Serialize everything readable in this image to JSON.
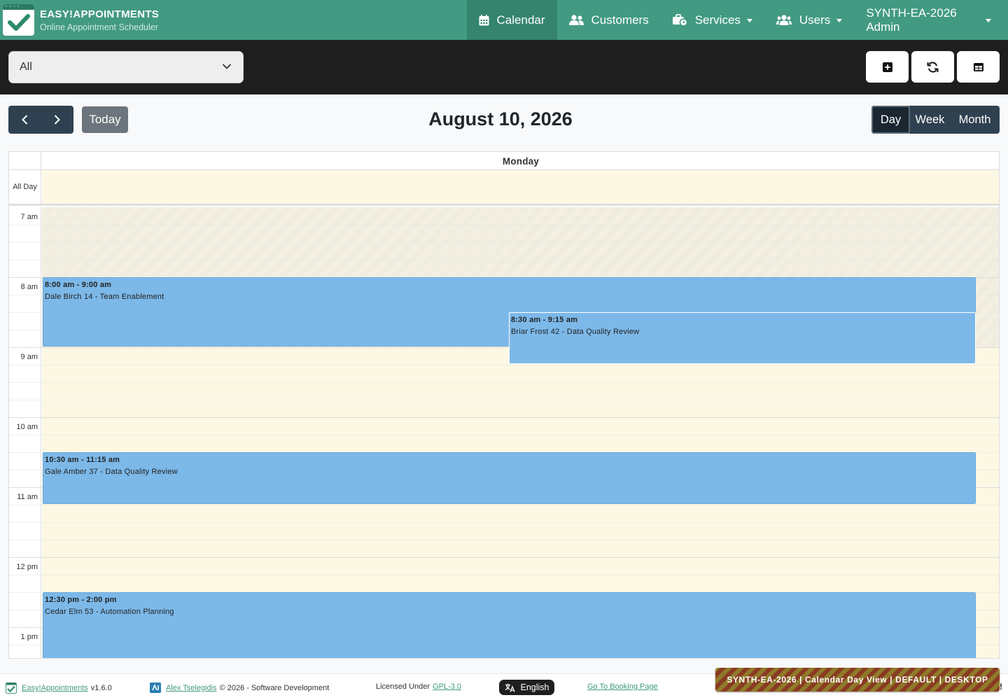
{
  "brand": {
    "name": "EASY!APPOINTMENTS",
    "tagline": "Online Appointment Scheduler"
  },
  "nav": {
    "calendar": "Calendar",
    "customers": "Customers",
    "services": "Services",
    "users": "Users",
    "account": "SYNTH-EA-2026 Admin"
  },
  "toolbar": {
    "filter_value": "All"
  },
  "calendar": {
    "today_label": "Today",
    "date_title": "August 10, 2026",
    "views": [
      "Day",
      "Week",
      "Month"
    ],
    "active_view": "Day",
    "day_name": "Monday",
    "all_day_label": "All Day",
    "time_labels": [
      "7 am",
      "8 am",
      "9 am",
      "10 am",
      "11 am",
      "12 pm",
      "1 pm"
    ],
    "events": [
      {
        "time": "8:00 am - 9:00 am",
        "desc": "Dale Birch 14 - Team Enablement"
      },
      {
        "time": "8:30 am - 9:15 am",
        "desc": "Briar Frost 42 - Data Quality Review"
      },
      {
        "time": "10:30 am - 11:15 am",
        "desc": "Gale Amber 37 - Data Quality Review"
      },
      {
        "time": "12:30 pm - 2:00 pm",
        "desc": "Cedar Elm 53 - Automation Planning"
      }
    ]
  },
  "footer": {
    "app_link": "Easy!Appointments",
    "version": "v1.6.0",
    "author_link": "Alex Tselegidis",
    "copyright": "© 2026 - Software Development",
    "license_prefix": "Licensed Under",
    "license_link": "GPL-3.0",
    "language": "English",
    "booking_link": "Go To Booking Page",
    "env_badge": "SYNTH-EA-2026 | Calendar Day View | DEFAULT | DESKTOP",
    "env_badge_tail": "!"
  },
  "colors": {
    "header": "#429a82",
    "toolbar": "#1e1e1e",
    "event": "#7cb8e8",
    "day_background": "#fcf8e3",
    "button_group": "#2f4150"
  }
}
